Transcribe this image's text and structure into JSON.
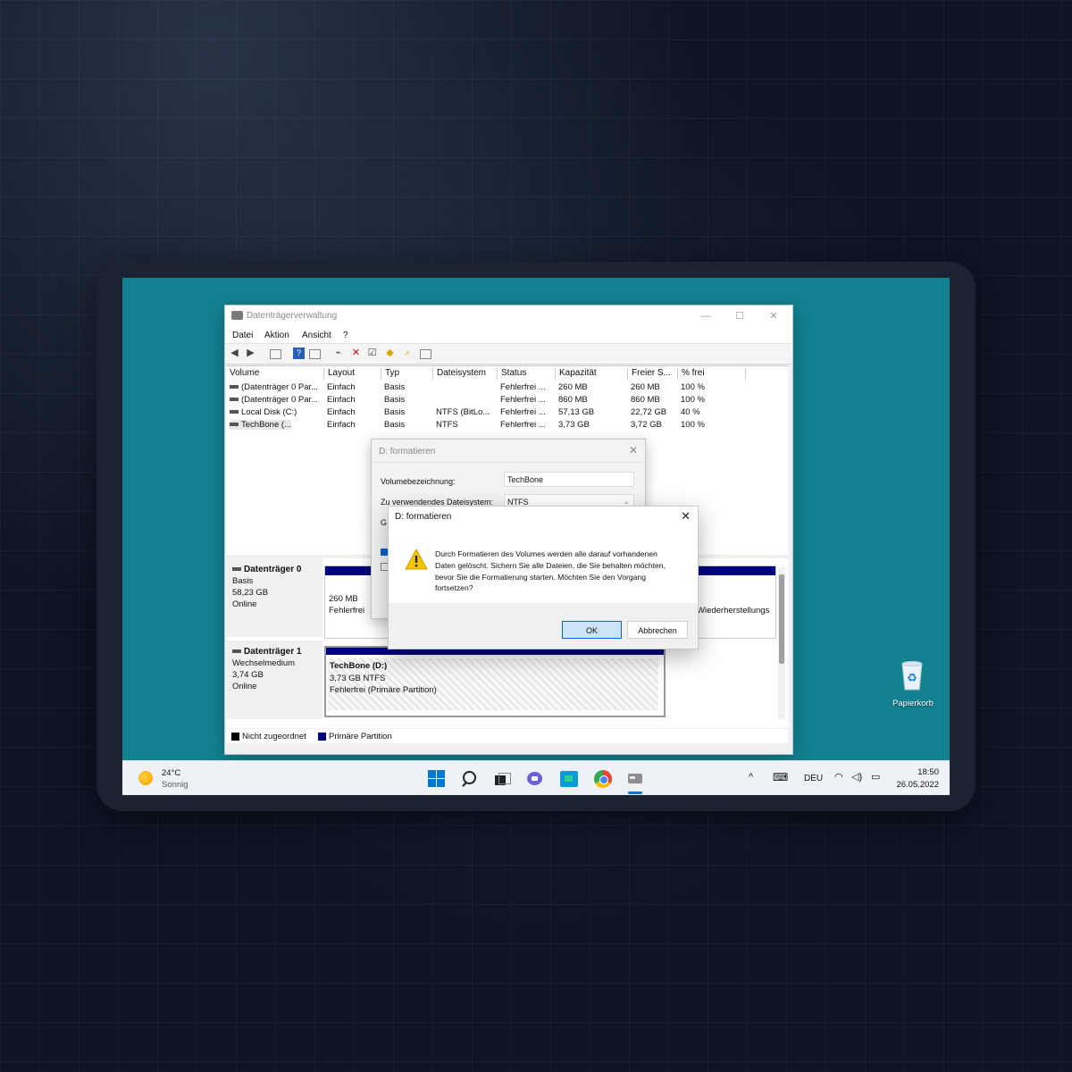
{
  "window": {
    "title": "Datenträgerverwaltung",
    "menu": [
      "Datei",
      "Aktion",
      "Ansicht",
      "?"
    ]
  },
  "volume_list": {
    "columns": [
      "Volume",
      "Layout",
      "Typ",
      "Dateisystem",
      "Status",
      "Kapazität",
      "Freier S...",
      "% frei"
    ],
    "rows": [
      [
        "(Datenträger 0 Par...",
        "Einfach",
        "Basis",
        "",
        "Fehlerfrei ...",
        "260 MB",
        "260 MB",
        "100 %"
      ],
      [
        "(Datenträger 0 Par...",
        "Einfach",
        "Basis",
        "",
        "Fehlerfrei ...",
        "860 MB",
        "860 MB",
        "100 %"
      ],
      [
        "Local Disk (C:)",
        "Einfach",
        "Basis",
        "NTFS (BitLo...",
        "Fehlerfrei ...",
        "57,13 GB",
        "22,72 GB",
        "40 %"
      ],
      [
        "TechBone (...",
        "Einfach",
        "Basis",
        "NTFS",
        "Fehlerfrei ...",
        "3,73 GB",
        "3,72 GB",
        "100 %"
      ]
    ]
  },
  "disks": {
    "disk0": {
      "name": "Datenträger 0",
      "type": "Basis",
      "size": "58,23 GB",
      "status": "Online",
      "part1_size": "260 MB",
      "part1_status": "Fehlerfrei",
      "part_right_status": "Wiederherstellungs"
    },
    "disk1": {
      "name": "Datenträger 1",
      "type": "Wechselmedium",
      "size": "3,74 GB",
      "status": "Online",
      "part_name": "TechBone  (D:)",
      "part_size": "3,73 GB NTFS",
      "part_status": "Fehlerfrei (Primäre Partition)"
    }
  },
  "legend": {
    "unallocated": "Nicht zugeordnet",
    "primary": "Primäre Partition",
    "unallocated_color": "#000000",
    "primary_color": "#000080"
  },
  "format_dialog": {
    "title": "D: formatieren",
    "label_volume": "Volumebezeichnung:",
    "volume_value": "TechBone",
    "label_fs": "Zu verwendendes Dateisystem:",
    "fs_value": "NTFS",
    "partial_label": "G"
  },
  "confirm_dialog": {
    "title": "D: formatieren",
    "message": "Durch Formatieren des Volumes werden alle darauf vorhandenen Daten gelöscht. Sichern Sie alle Dateien, die Sie behalten möchten, bevor Sie die Formatierung starten. Möchten Sie den Vorgang fortsetzen?",
    "ok": "OK",
    "cancel": "Abbrechen",
    "icon": "warning-icon"
  },
  "desktop": {
    "recycle_bin": "Papierkorb"
  },
  "taskbar": {
    "weather_temp": "24°C",
    "weather_desc": "Sonnig",
    "language": "DEU",
    "time": "18:50",
    "date": "26.05.2022",
    "accent": "#0078d4"
  }
}
